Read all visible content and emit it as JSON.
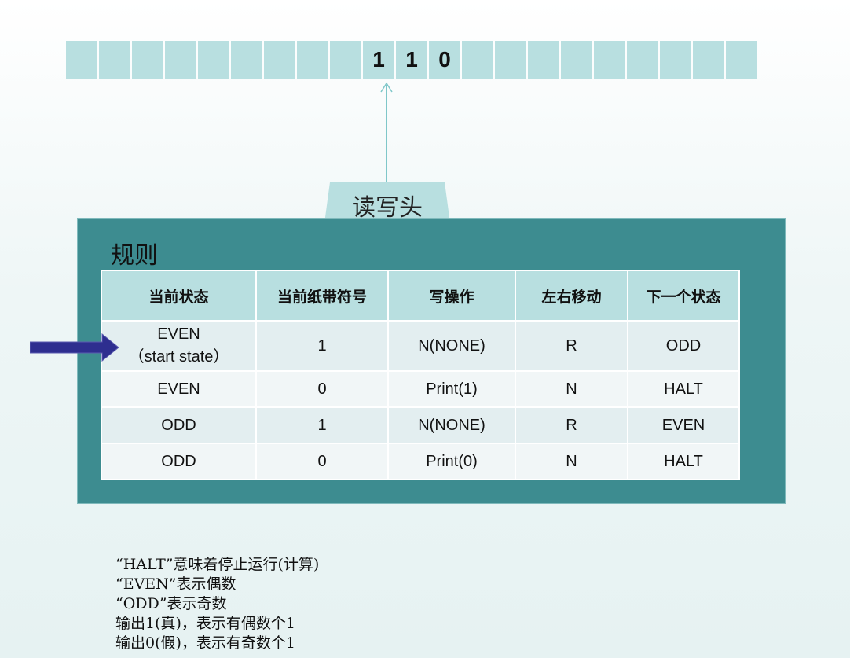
{
  "tape": {
    "cells": [
      "",
      "",
      "",
      "",
      "",
      "",
      "",
      "",
      "",
      "1",
      "1",
      "0",
      "",
      "",
      "",
      "",
      "",
      "",
      "",
      "",
      "",
      ""
    ]
  },
  "head": {
    "label": "读写头"
  },
  "rules": {
    "title": "规则",
    "headers": [
      "当前状态",
      "当前纸带符号",
      "写操作",
      "左右移动",
      "下一个状态"
    ],
    "rows": [
      {
        "state": "EVEN",
        "state_note": "（start state）",
        "symbol": "1",
        "write": "N(NONE)",
        "move": "R",
        "next": "ODD"
      },
      {
        "state": "EVEN",
        "state_note": "",
        "symbol": "0",
        "write": "Print(1)",
        "move": "N",
        "next": "HALT"
      },
      {
        "state": "ODD",
        "state_note": "",
        "symbol": "1",
        "write": "N(NONE)",
        "move": "R",
        "next": "EVEN"
      },
      {
        "state": "ODD",
        "state_note": "",
        "symbol": "0",
        "write": "Print(0)",
        "move": "N",
        "next": "HALT"
      }
    ]
  },
  "notes": [
    "“HALT”意味着停止运行(计算)",
    "“EVEN”表示偶数",
    "“ODD”表示奇数",
    "输出1(真)，表示有偶数个1",
    "输出0(假)，表示有奇数个1"
  ],
  "colors": {
    "tape_cell": "#b8dfe0",
    "panel": "#3d8c90",
    "header_cell": "#b8dfe0",
    "arrow": "#2e2e8f"
  }
}
